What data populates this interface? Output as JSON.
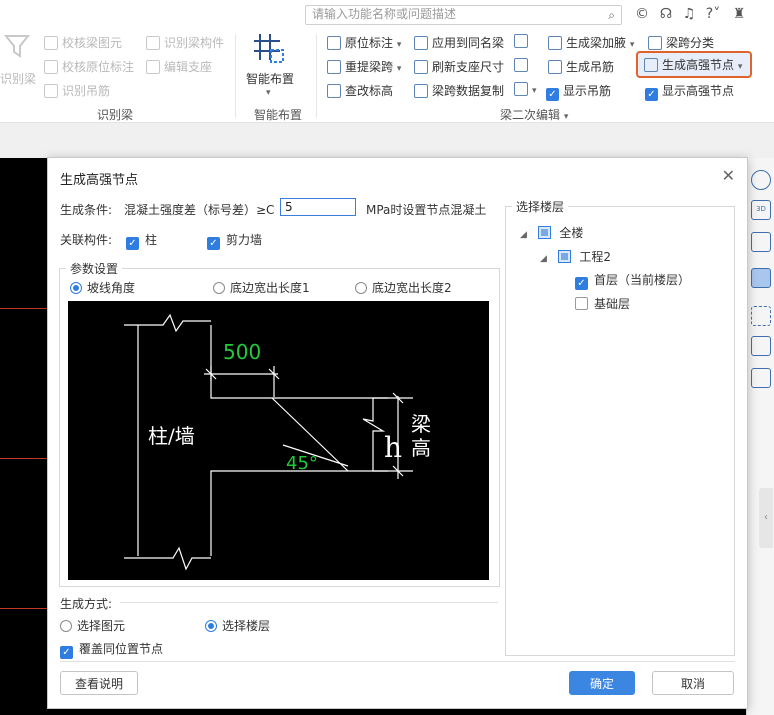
{
  "search": {
    "placeholder": "请输入功能名称或问题描述"
  },
  "topicons": [
    "copyright-icon",
    "headset-icon",
    "help-icon",
    "shirt-icon"
  ],
  "ribbon": {
    "identify_beam": {
      "big_label": "识别梁",
      "check_beam": "校核梁图元",
      "check_orig": "校核原位标注",
      "identify_hanger": "识别吊筋",
      "identify_member": "识别梁构件",
      "edit_support": "编辑支座",
      "group": "识别梁"
    },
    "smart": {
      "label": "智能布置",
      "group": "智能布置"
    },
    "second": {
      "orig_mark": "原位标注",
      "reextract": "重提梁跨",
      "check_elev": "查改标高",
      "apply_same": "应用到同名梁",
      "refresh_support": "刷新支座尺寸",
      "span_copy": "梁跨数据复制",
      "gen_haunch": "生成梁加腋",
      "gen_hanger": "生成吊筋",
      "show_hanger": "显示吊筋",
      "span_class": "梁跨分类",
      "gen_hs_node": "生成高强节点",
      "show_hs_node": "显示高强节点",
      "group": "梁二次编辑"
    }
  },
  "dialog": {
    "title": "生成高强节点",
    "cond_label": "生成条件:",
    "cond_text": "混凝土强度差（标号差）≥C",
    "cond_value": "5",
    "cond_suffix": "MPa时设置节点混凝土",
    "assoc_label": "关联构件:",
    "assoc_col": "柱",
    "assoc_wall": "剪力墙",
    "params_legend": "参数设置",
    "radio_slope": "坡线角度",
    "radio_ext1": "底边宽出长度1",
    "radio_ext2": "底边宽出长度2",
    "diagram": {
      "dim500": "500",
      "col_wall": "柱/墙",
      "angle": "45°",
      "h": "h",
      "beam1": "梁",
      "beam2": "高"
    },
    "method_label": "生成方式:",
    "method_sel_elem": "选择图元",
    "method_sel_floor": "选择楼层",
    "overwrite": "覆盖同位置节点",
    "floor_legend": "选择楼层",
    "tree": {
      "all": "全楼",
      "project": "工程2",
      "floor1": "首层（当前楼层）",
      "base": "基础层"
    },
    "btn_help": "查看说明",
    "btn_ok": "确定",
    "btn_cancel": "取消"
  },
  "colors": {
    "accent": "#2f7de1",
    "highlight_border": "#e0622d",
    "diagram_green": "#22c93a"
  }
}
